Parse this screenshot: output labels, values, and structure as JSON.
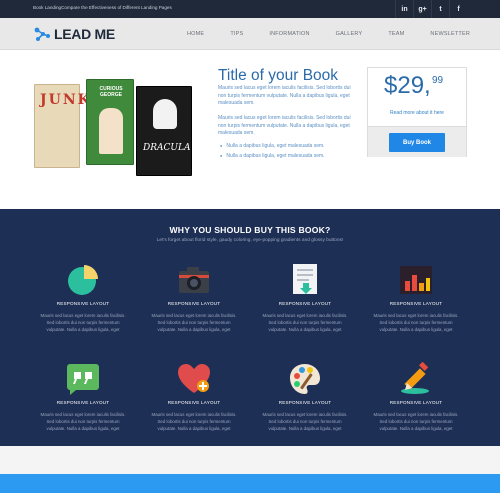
{
  "topbar": {
    "tagline": "Book LandingCompare the Effectiveness of Different Landing Pages",
    "social": [
      {
        "icon": "linkedin-icon",
        "glyph": "in"
      },
      {
        "icon": "google-plus-icon",
        "glyph": "g+"
      },
      {
        "icon": "twitter-icon",
        "glyph": "t"
      },
      {
        "icon": "facebook-icon",
        "glyph": "f"
      }
    ]
  },
  "nav": {
    "logo": "LEAD ME",
    "items": [
      "HOME",
      "TIPS",
      "INFORMATION",
      "GALLERY",
      "TEAM",
      "NEWSLETTER"
    ]
  },
  "hero": {
    "title": "Title of your Book",
    "para1": "Mauris sed lacus eget lorem iaculis facilisis. Sed lobortis dui non turpis fermentum vulputate. Nulla a dapibus ligula, eget malesuada sem.",
    "para2": "Mauris sed lacus eget lorem iaculis facilisis. Sed lobortis dui non turpis fermentum vulputate. Nulla a dapibus ligula, eget malesuada sem.",
    "bullets": [
      "Nulla a dapibus ligula, eget malesuada sem.",
      "Nulla a dapibus ligula, eget malesuada sem."
    ],
    "books": [
      {
        "title": "JUNKIE"
      },
      {
        "title": "CURIOUS GEORGE"
      },
      {
        "title": "DRACULA"
      }
    ],
    "price": {
      "dollars": "$29,",
      "cents": "99",
      "more": "Read more about it here",
      "buy": "Buy Book"
    }
  },
  "features": {
    "title": "WHY YOU SHOULD BUY THIS BOOK?",
    "subtitle": "Let's forget about florid style, gaudy coloring, eye-popping gradients and glossy buttons!",
    "items": [
      {
        "icon": "pie-chart-icon",
        "label": "RESPONSIVE LAYOUT",
        "desc": "Mauris sed lacus eget lorem iaculis facilisis. Sed lobortis dui non turpis fermentum vulputate. Nulla a dapibus ligula, eget"
      },
      {
        "icon": "camera-icon",
        "label": "RESPONSIVE LAYOUT",
        "desc": "Mauris sed lacus eget lorem iaculis facilisis. Sed lobortis dui non turpis fermentum vulputate. Nulla a dapibus ligula, eget"
      },
      {
        "icon": "document-download-icon",
        "label": "RESPONSIVE LAYOUT",
        "desc": "Mauris sed lacus eget lorem iaculis facilisis. Sed lobortis dui non turpis fermentum vulputate. Nulla a dapibus ligula, eget"
      },
      {
        "icon": "bar-chart-icon",
        "label": "RESPONSIVE LAYOUT",
        "desc": "Mauris sed lacus eget lorem iaculis facilisis. Sed lobortis dui non turpis fermentum vulputate. Nulla a dapibus ligula, eget"
      },
      {
        "icon": "quote-icon",
        "label": "RESPONSIVE LAYOUT",
        "desc": "Mauris sed lacus eget lorem iaculis facilisis. Sed lobortis dui non turpis fermentum vulputate. Nulla a dapibus ligula, eget"
      },
      {
        "icon": "heart-add-icon",
        "label": "RESPONSIVE LAYOUT",
        "desc": "Mauris sed lacus eget lorem iaculis facilisis. Sed lobortis dui non turpis fermentum vulputate. Nulla a dapibus ligula, eget"
      },
      {
        "icon": "palette-icon",
        "label": "RESPONSIVE LAYOUT",
        "desc": "Mauris sed lacus eget lorem iaculis facilisis. Sed lobortis dui non turpis fermentum vulputate. Nulla a dapibus ligula, eget"
      },
      {
        "icon": "pencil-icon",
        "label": "RESPONSIVE LAYOUT",
        "desc": "Mauris sed lacus eget lorem iaculis facilisis. Sed lobortis dui non turpis fermentum vulputate. Nulla a dapibus ligula, eget"
      }
    ]
  },
  "colors": {
    "topbar": "#20293a",
    "accent": "#2b6ba8",
    "buy_button": "#2187e7",
    "features_bg": "#1e2f55",
    "footer_strip": "#2b9af0"
  }
}
